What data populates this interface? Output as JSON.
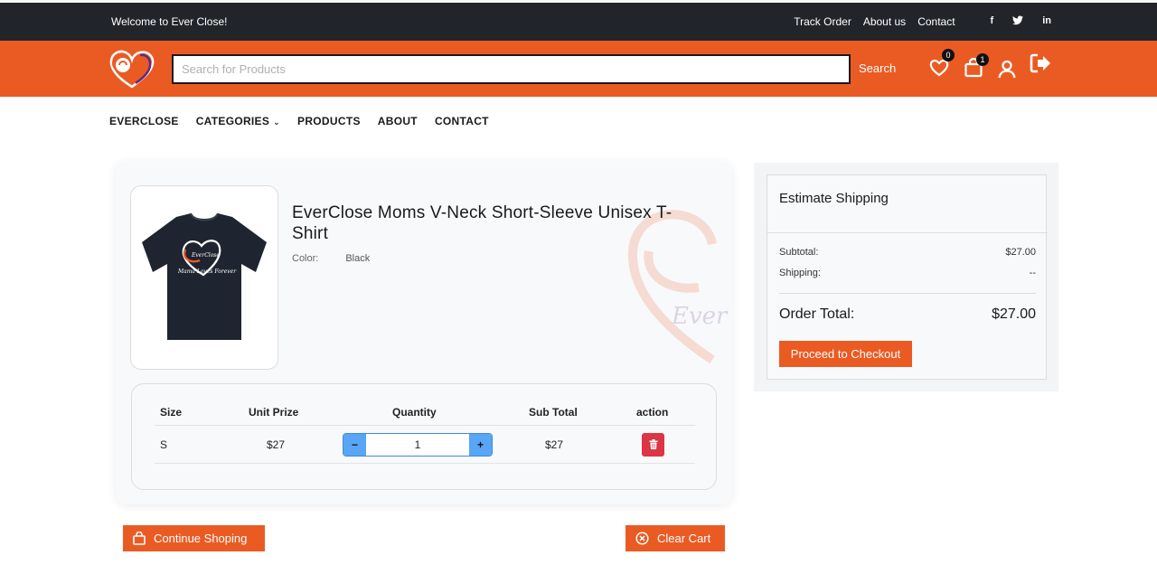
{
  "topbar": {
    "welcome": "Welcome to Ever Close!",
    "links": [
      "Track Order",
      "About us",
      "Contact"
    ],
    "social": [
      "f",
      "twitter",
      "in"
    ]
  },
  "header": {
    "search_placeholder": "Search for Products",
    "search_label": "Search",
    "wishlist_count": "0",
    "cart_count": "1"
  },
  "nav": {
    "items": [
      "EVERCLOSE",
      "CATEGORIES",
      "PRODUCTS",
      "ABOUT",
      "CONTACT"
    ]
  },
  "product": {
    "title": "EverClose Moms V-Neck Short-Sleeve Unisex T-Shirt",
    "color_label": "Color:",
    "color_value": "Black",
    "table": {
      "headers": [
        "Size",
        "Unit Prize",
        "Quantity",
        "Sub Total",
        "action"
      ],
      "row": {
        "size": "S",
        "unit_price": "$27",
        "quantity": "1",
        "subtotal": "$27"
      },
      "minus": "−",
      "plus": "+"
    }
  },
  "summary": {
    "title": "Estimate Shipping",
    "subtotal_label": "Subtotal:",
    "subtotal_value": "$27.00",
    "shipping_label": "Shipping:",
    "shipping_value": "--",
    "total_label": "Order Total:",
    "total_value": "$27.00",
    "checkout_label": "Proceed to Checkout"
  },
  "actions": {
    "continue_label": "Continue Shoping",
    "clear_label": "Clear Cart"
  },
  "colors": {
    "accent": "#ea5b24",
    "topbar": "#212529",
    "danger": "#dc3545",
    "qty": "#58a6f5"
  }
}
